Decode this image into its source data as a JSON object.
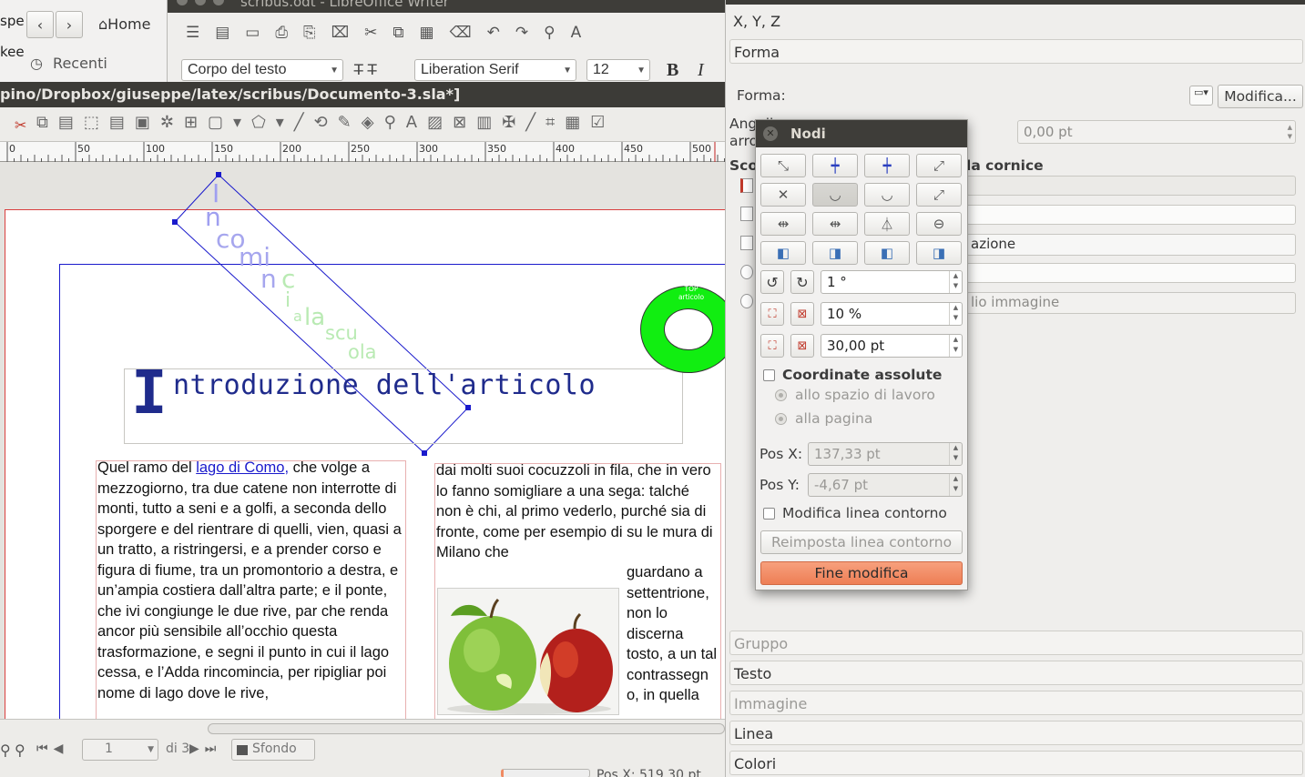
{
  "background_apps": {
    "left_cut_1": "spe",
    "left_cut_2": "kee",
    "home_label": "Home",
    "recent_label": "Recenti",
    "writer_title": "scribus.odt - LibreOffice Writer",
    "para_style": "Corpo del testo",
    "font_name": "Liberation Serif",
    "font_size": "12"
  },
  "scribus": {
    "title": "pino/Dropbox/giuseppe/latex/scribus/Documento-3.sla*]",
    "ruler_ticks": [
      "0",
      "50",
      "100",
      "150",
      "200",
      "250",
      "300",
      "350",
      "400",
      "450",
      "500"
    ],
    "heading": "ntroduzione dell'articolo",
    "dropcap": "I",
    "diagonal_text": [
      "I",
      "n",
      "co",
      "mi",
      "n",
      "c",
      "i",
      "a",
      "la",
      "scu",
      "ola"
    ],
    "badge_text": "TOP articolo",
    "col1_prefix": "Quel ramo del ",
    "col1_link": "lago di Como,",
    "col1_rest": " che volge a mezzogiorno, tra due catene non interrotte di monti, tutto a seni e a golfi, a seconda dello sporgere e del rientrare di quelli, vien, quasi a un tratto, a ristringersi, e a prender corso e figura di fiume, tra un promontorio a destra, e un’ampia costiera dall’altra parte; e il ponte, che ivi congiunge le due rive, par che renda ancor più sensibile all’occhio questa trasformazione, e segni il punto in cui il lago cessa, e l’Adda rincomincia, per ripigliar poi nome di lago dove le rive,",
    "col2_top": "dai molti suoi cocuzzoli in fila, che in vero lo fanno somigliare a una sega: talché non è chi, al primo vederlo, purché sia di fronte, come per esempio di su le mura di Milano che",
    "col2_side": "guardano a settentrione, non lo discerna tosto, a un tal contrassegn o, in quella",
    "page_value": "1",
    "page_of": "di 3",
    "layer": "Sfondo",
    "pos_status": "Pos X: 519,30 pt"
  },
  "properties": {
    "xyz": "X, Y, Z",
    "forma": "Forma",
    "forma_label": "Forma:",
    "modifica": "Modifica...",
    "angoli_1": "Angoli",
    "angoli_2": "arro",
    "angoli_value": "0,00 pt",
    "scorr": "Sco",
    "cornice_label": "la cornice",
    "opt_1": "azione",
    "opt_2": "lio immagine",
    "sections": [
      "Gruppo",
      "Testo",
      "Immagine",
      "Linea",
      "Colori"
    ]
  },
  "nodi": {
    "title": "Nodi",
    "rotation": "1 °",
    "scale_pct": "10 %",
    "scale_pt": "30,00 pt",
    "abs_coords": "Coordinate assolute",
    "to_workspace": "allo spazio di lavoro",
    "to_page": "alla pagina",
    "pos_x_label": "Pos X:",
    "pos_x": "137,33 pt",
    "pos_y_label": "Pos Y:",
    "pos_y": "-4,67 pt",
    "edit_contour": "Modifica linea contorno",
    "reset_contour": "Reimposta linea contorno",
    "finish": "Fine modifica"
  },
  "colors": {
    "accent": "#f08a62",
    "selection": "#1a1acc",
    "frame_red": "#d94040",
    "badge": "#11ee11"
  }
}
